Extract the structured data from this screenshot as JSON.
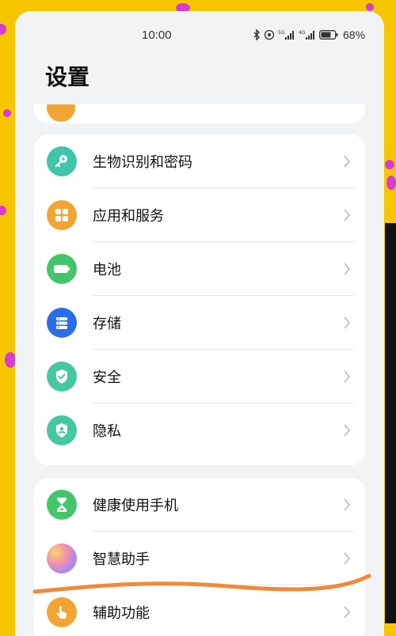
{
  "status_bar": {
    "time": "10:00",
    "battery": "68%",
    "icons": [
      "bluetooth-icon",
      "nfc-icon",
      "signal-5g-icon",
      "signal-4g-icon",
      "battery-icon"
    ]
  },
  "header": {
    "title": "设置"
  },
  "settings": {
    "group_a": [
      {
        "label": "生物识别和密码",
        "icon": "key-icon",
        "color": "#3fc5a8"
      },
      {
        "label": "应用和服务",
        "icon": "apps-grid-icon",
        "color": "#f3a533"
      },
      {
        "label": "电池",
        "icon": "battery-icon",
        "color": "#45c56b"
      },
      {
        "label": "存储",
        "icon": "storage-icon",
        "color": "#2a6de8"
      },
      {
        "label": "安全",
        "icon": "shield-check-icon",
        "color": "#45c8a0"
      },
      {
        "label": "隐私",
        "icon": "privacy-shield-icon",
        "color": "#45c8a0"
      }
    ],
    "group_b": [
      {
        "label": "健康使用手机",
        "icon": "hourglass-icon",
        "color": "#45c56b"
      },
      {
        "label": "智慧助手",
        "icon": "assistant-orb-icon",
        "color": "#c586e8"
      },
      {
        "label": "辅助功能",
        "icon": "hand-icon",
        "color": "#f3a533"
      }
    ]
  },
  "colors": {
    "background": "#f7c600",
    "annotation": "#f08a3a"
  }
}
